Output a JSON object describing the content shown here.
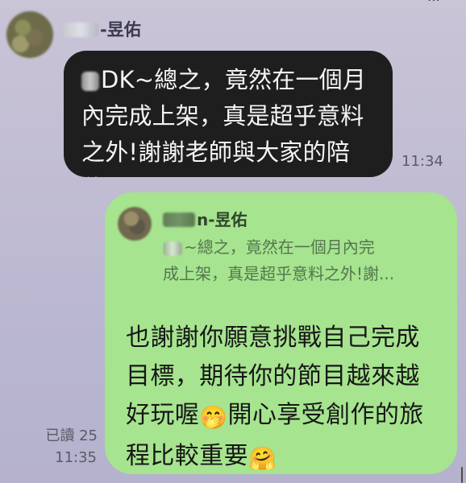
{
  "icons": {
    "top_right": "more-options-icon"
  },
  "incoming": {
    "sender_name": "-昱佑",
    "message_prefix": "DK~總之，竟然在一個月內完成上架，真是超乎意料之外!謝謝老師與大家的陪伴！",
    "time": "11:34"
  },
  "outgoing": {
    "quoted_sender": "n-昱佑",
    "quoted_line_1": "~總之，竟然在一個月內完",
    "quoted_line_2": "成上架，真是超乎意料之外!謝...",
    "message_part_1": "也謝謝你願意挑戰自己完成目標，期待你的節目越來越好玩喔",
    "emoji_1": "🤭",
    "message_part_2": "開心享受創作的旅程比較重要",
    "emoji_2": "🤗",
    "read_status": "已讀 25",
    "time": "11:35"
  }
}
